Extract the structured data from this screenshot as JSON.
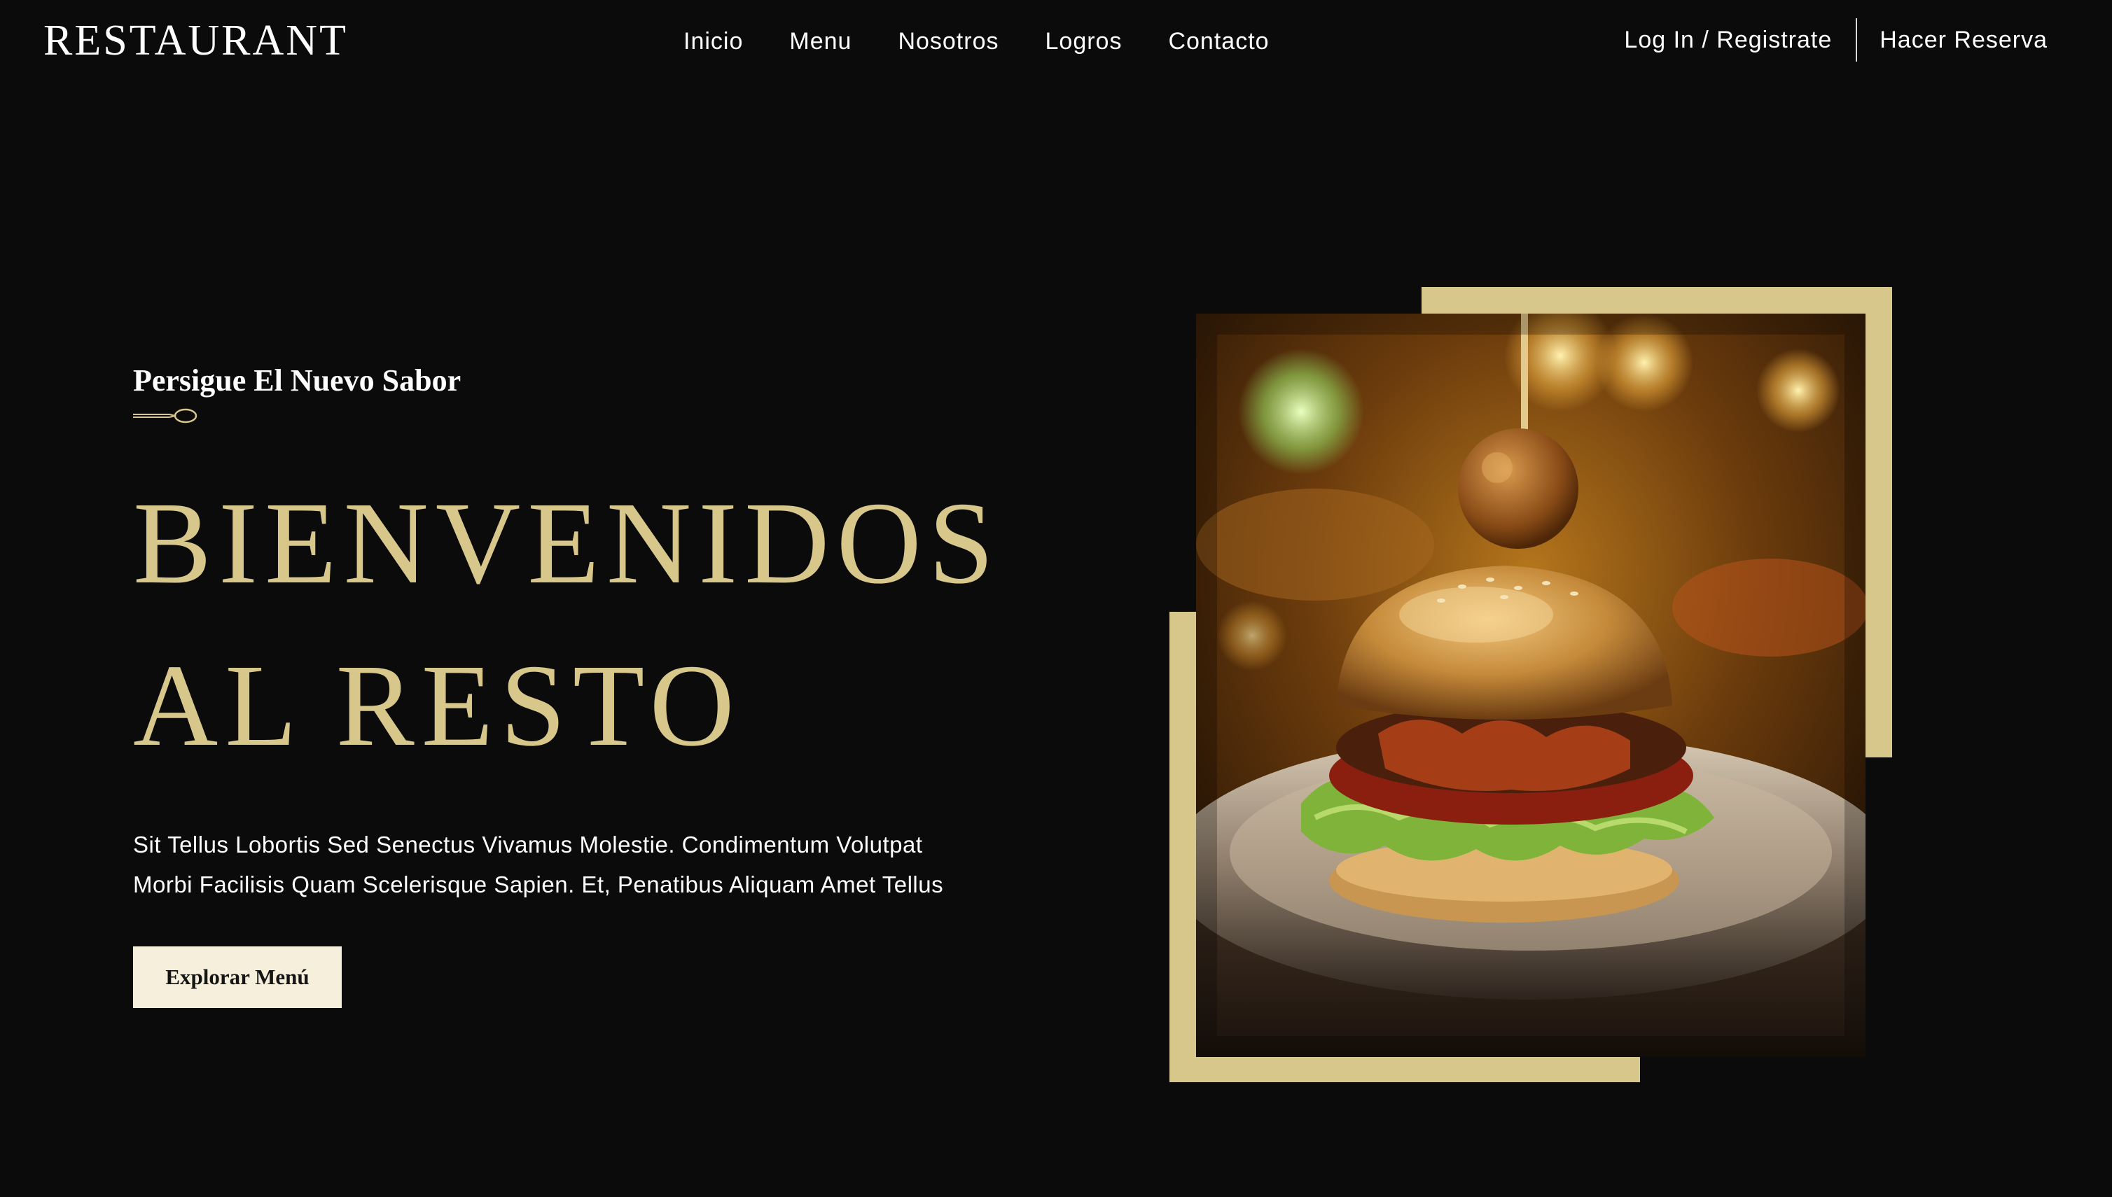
{
  "header": {
    "logo": "RESTAURANT",
    "nav": [
      "Inicio",
      "Menu",
      "Nosotros",
      "Logros",
      "Contacto"
    ],
    "login": "Log In / Registrate",
    "reserve": "Hacer Reserva"
  },
  "hero": {
    "tagline": "Persigue El Nuevo Sabor",
    "title_line1": "BIENVENIDOS",
    "title_line2": "AL RESTO",
    "desc_line1": "Sit Tellus Lobortis Sed Senectus Vivamus Molestie. Condimentum Volutpat",
    "desc_line2": "Morbi Facilisis Quam Scelerisque Sapien. Et, Penatibus Aliquam Amet Tellus",
    "cta": "Explorar Menú"
  },
  "colors": {
    "background": "#0b0b0b",
    "accent_gold": "#d7c78b",
    "button_bg": "#f5efdc"
  },
  "icons": {
    "divider": "spoon-icon"
  },
  "image": {
    "subject": "burger-photo"
  }
}
